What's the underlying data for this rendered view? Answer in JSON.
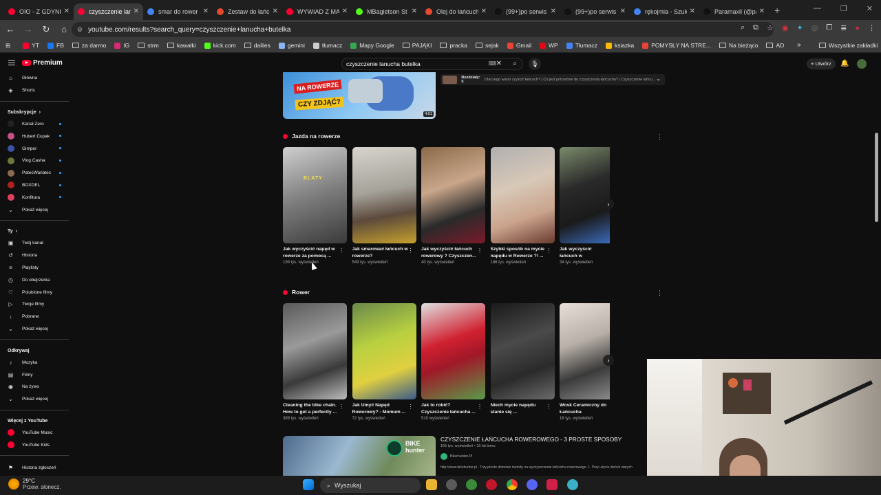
{
  "browser": {
    "tabs": [
      {
        "title": "OIO - Z GDYNI",
        "fav": "#ff0033",
        "icon": "youtube-icon",
        "active": false
      },
      {
        "title": "czyszczenie lanu",
        "fav": "#ff0033",
        "icon": "youtube-icon",
        "active": true
      },
      {
        "title": "smar do rower",
        "fav": "#4285f4",
        "icon": "google-icon",
        "active": false
      },
      {
        "title": "Zestaw do łańc",
        "fav": "#e54a2e",
        "icon": "allegro-icon",
        "active": false
      },
      {
        "title": "WYWIAD Z MA",
        "fav": "#ff0033",
        "icon": "youtube-icon",
        "active": false
      },
      {
        "title": "MBagietson St",
        "fav": "#53fc18",
        "icon": "kick-icon",
        "active": false
      },
      {
        "title": "Olej do łańcuch",
        "fav": "#e54a2e",
        "icon": "allegro-icon",
        "active": false
      },
      {
        "title": "(99+)po serwis",
        "fav": "#111111",
        "icon": "tiktok-icon",
        "active": false
      },
      {
        "title": "(99+)po serwis",
        "fav": "#111111",
        "icon": "tiktok-icon",
        "active": false
      },
      {
        "title": "rękojmia - Szuk",
        "fav": "#4285f4",
        "icon": "google-icon",
        "active": false
      },
      {
        "title": "Paramaxil (@pa",
        "fav": "#111111",
        "icon": "tiktok-icon",
        "active": false
      }
    ],
    "url": "youtube.com/results?search_query=czyszczenie+lanucha+butelka",
    "bookmarks": [
      {
        "label": "YT",
        "color": "#ff0033"
      },
      {
        "label": "FB",
        "color": "#1877f2"
      },
      {
        "label": "za darmo",
        "color": "folder"
      },
      {
        "label": "IG",
        "color": "#d62976"
      },
      {
        "label": "strm",
        "color": "folder"
      },
      {
        "label": "kawałki",
        "color": "folder"
      },
      {
        "label": "kick.com",
        "color": "#53fc18"
      },
      {
        "label": "dailies",
        "color": "folder"
      },
      {
        "label": "gemini",
        "color": "#8ab4f8"
      },
      {
        "label": "tłumacz",
        "color": "#cccccc"
      },
      {
        "label": "Mapy Google",
        "color": "#34a853"
      },
      {
        "label": "PAJĄKI",
        "color": "folder"
      },
      {
        "label": "pracka",
        "color": "folder"
      },
      {
        "label": "sejak",
        "color": "folder"
      },
      {
        "label": "Gmail",
        "color": "#ea4335"
      },
      {
        "label": "WP",
        "color": "#e30613"
      },
      {
        "label": "Tłumacz",
        "color": "#4285f4"
      },
      {
        "label": "ksiazka",
        "color": "#fbbc05"
      },
      {
        "label": "POMYSŁY NA STRE...",
        "color": "#ea4335"
      },
      {
        "label": "Na bieżąco",
        "color": "folder"
      },
      {
        "label": "AD",
        "color": "folder"
      }
    ],
    "all_bookmarks": "Wszystkie zakładki"
  },
  "youtube": {
    "logo_text": "Premium",
    "search_value": "czyszczenie lanucha butelka",
    "create_label": "+ Utwórz",
    "sidebar": {
      "main": [
        {
          "label": "Główna",
          "icon": "home-icon",
          "glyph": "⌂"
        },
        {
          "label": "Shorts",
          "icon": "shorts-icon",
          "glyph": "◈"
        }
      ],
      "subs_header": "Subskrypcje",
      "subs": [
        {
          "label": "Kanał Zero",
          "color": "#222222"
        },
        {
          "label": "Hubert Cupak",
          "color": "#c8508a"
        },
        {
          "label": "Gimper",
          "color": "#3a52a8"
        },
        {
          "label": "Vlog Casha",
          "color": "#6b7a3a"
        },
        {
          "label": "PatecWariatec",
          "color": "#8a6a50"
        },
        {
          "label": "BOXDEL",
          "color": "#b02020"
        },
        {
          "label": "Konfitura",
          "color": "#e04060"
        }
      ],
      "subs_more": "Pokaż więcej",
      "you_header": "Ty",
      "you": [
        {
          "label": "Twój kanał",
          "icon": "channel-icon",
          "glyph": "▣"
        },
        {
          "label": "Historia",
          "icon": "history-icon",
          "glyph": "↺"
        },
        {
          "label": "Playlisty",
          "icon": "playlist-icon",
          "glyph": "≡"
        },
        {
          "label": "Do obejrzenia",
          "icon": "clock-icon",
          "glyph": "◷"
        },
        {
          "label": "Polubione filmy",
          "icon": "like-icon",
          "glyph": "♡"
        },
        {
          "label": "Twoje filmy",
          "icon": "video-icon",
          "glyph": "▷"
        },
        {
          "label": "Pobrane",
          "icon": "download-icon",
          "glyph": "↓"
        },
        {
          "label": "Pokaż więcej",
          "icon": "chevron-down-icon",
          "glyph": "⌄"
        }
      ],
      "explore_header": "Odkrywaj",
      "explore": [
        {
          "label": "Muzyka",
          "icon": "music-icon",
          "glyph": "♪"
        },
        {
          "label": "Filmy",
          "icon": "film-icon",
          "glyph": "▤"
        },
        {
          "label": "Na żywo",
          "icon": "live-icon",
          "glyph": "◉"
        },
        {
          "label": "Pokaż więcej",
          "icon": "chevron-down-icon",
          "glyph": "⌄"
        }
      ],
      "more_header": "Więcej z YouTube",
      "more": [
        {
          "label": "YouTube Music",
          "color": "#ff0033"
        },
        {
          "label": "YouTube Kids",
          "color": "#ff0033"
        }
      ],
      "report": "Historia zgłoszeń"
    },
    "top_video": {
      "thumb_text_1": "NA ROWERZE",
      "thumb_text_2": "CZY ZDJĄĆ?",
      "duration": "4:51",
      "chapters_label": "Rozdziały: 5",
      "chapters_text": "Dlaczego warto czyścić łańcuch? | Co jest potrzebne do czyszczenia łańcucha? | Czyszczenie łańcu..."
    },
    "shelves": [
      {
        "title": "Jazda na rowerze",
        "items": [
          {
            "title": "Jak wyczyścić napęd w rowerze za pomocą ...",
            "views": "199 tys. wyświetleń",
            "bg": "linear-gradient(160deg,#cfcfcf,#7d7d7d 50%,#3a3a3a)",
            "overlay": "BLATY"
          },
          {
            "title": "Jak smarować łańcuch w rowerze?",
            "views": "549 tys. wyświetleń",
            "bg": "linear-gradient(170deg,#d7d4cd,#a5a29a 45%,#5c4a3c 70%,#c5a02c)"
          },
          {
            "title": "Jak wyczyścić łańcuch rowerowy ? Czyszczen...",
            "views": "40 tys. wyświetleń",
            "bg": "linear-gradient(160deg,#8a6a4a,#c9a68a 40%,#2a2a2a 70%,#7a1a2a)"
          },
          {
            "title": "Szybki sposób na mycie napędu w Rowerze ?! ...",
            "views": "186 tys. wyświetleń",
            "bg": "linear-gradient(160deg,#b0b0b0,#d8c8b8 40%,#caa48c 70%,#6a3a30)"
          },
          {
            "title": "Jak wyczyścić łańcuch w ekspresowym tempi...",
            "views": "34 tys. wyświetleń",
            "bg": "linear-gradient(160deg,#7a8a6a,#2a2a2a 40%,#1a1a1a 70%,#3a6ab8)"
          }
        ]
      },
      {
        "title": "Rower",
        "items": [
          {
            "title": "Cleaning the bike chain. How to get a perfectly ...",
            "views": "389 tys. wyświetleń",
            "bg": "linear-gradient(160deg,#5a5a5a,#9a9a9a 40%,#3a3a3a 70%,#bcbcbc)"
          },
          {
            "title": "Jak Umyć Napęd Rowerowy? - Momum ...",
            "views": "72 tys. wyświetleń",
            "bg": "linear-gradient(160deg,#6a8a4a,#b8d040 40%,#e0d040 70%,#3a5a8a)"
          },
          {
            "title": "Jak to robić? Czyszczenie łańcucha ...",
            "views": "510 wyświetleń",
            "bg": "linear-gradient(160deg,#e0e0e0,#d02030 40%,#a01828 60%,#5a9a4a)"
          },
          {
            "title": "Niech mycie napędu stanie się ...",
            "views": "",
            "bg": "linear-gradient(160deg,#1a1a1a,#4a4a4a 40%,#2a2a2a 70%,#6a6a6a)"
          },
          {
            "title": "Wosk Ceramiczny do Łańcucha Rowerowego...",
            "views": "18 tys. wyświetleń",
            "bg": "linear-gradient(160deg,#e8e0d8,#b8b0a8 40%,#3a3a3a 70%,#8a8a8a)"
          }
        ]
      }
    ],
    "bottom_video": {
      "title": "CZYSZCZENIE ŁAŃCUCHA ROWEROWEGO - 3 PROSTE SPOSOBY",
      "meta": "165 tys. wyświetleń • 10 lat temu",
      "channel": "Bikehunter.Pl",
      "desc": "http://www.bikehunter.pl - Trzy proste domowe metody na wyczyszczenie łańcucha rowerowego. 1. Przy użyciu dwóch starych",
      "logo_text": "BIKE hunter"
    }
  },
  "taskbar": {
    "temp": "29°C",
    "weather": "Przew. słonecz.",
    "search": "Wyszukaj"
  }
}
